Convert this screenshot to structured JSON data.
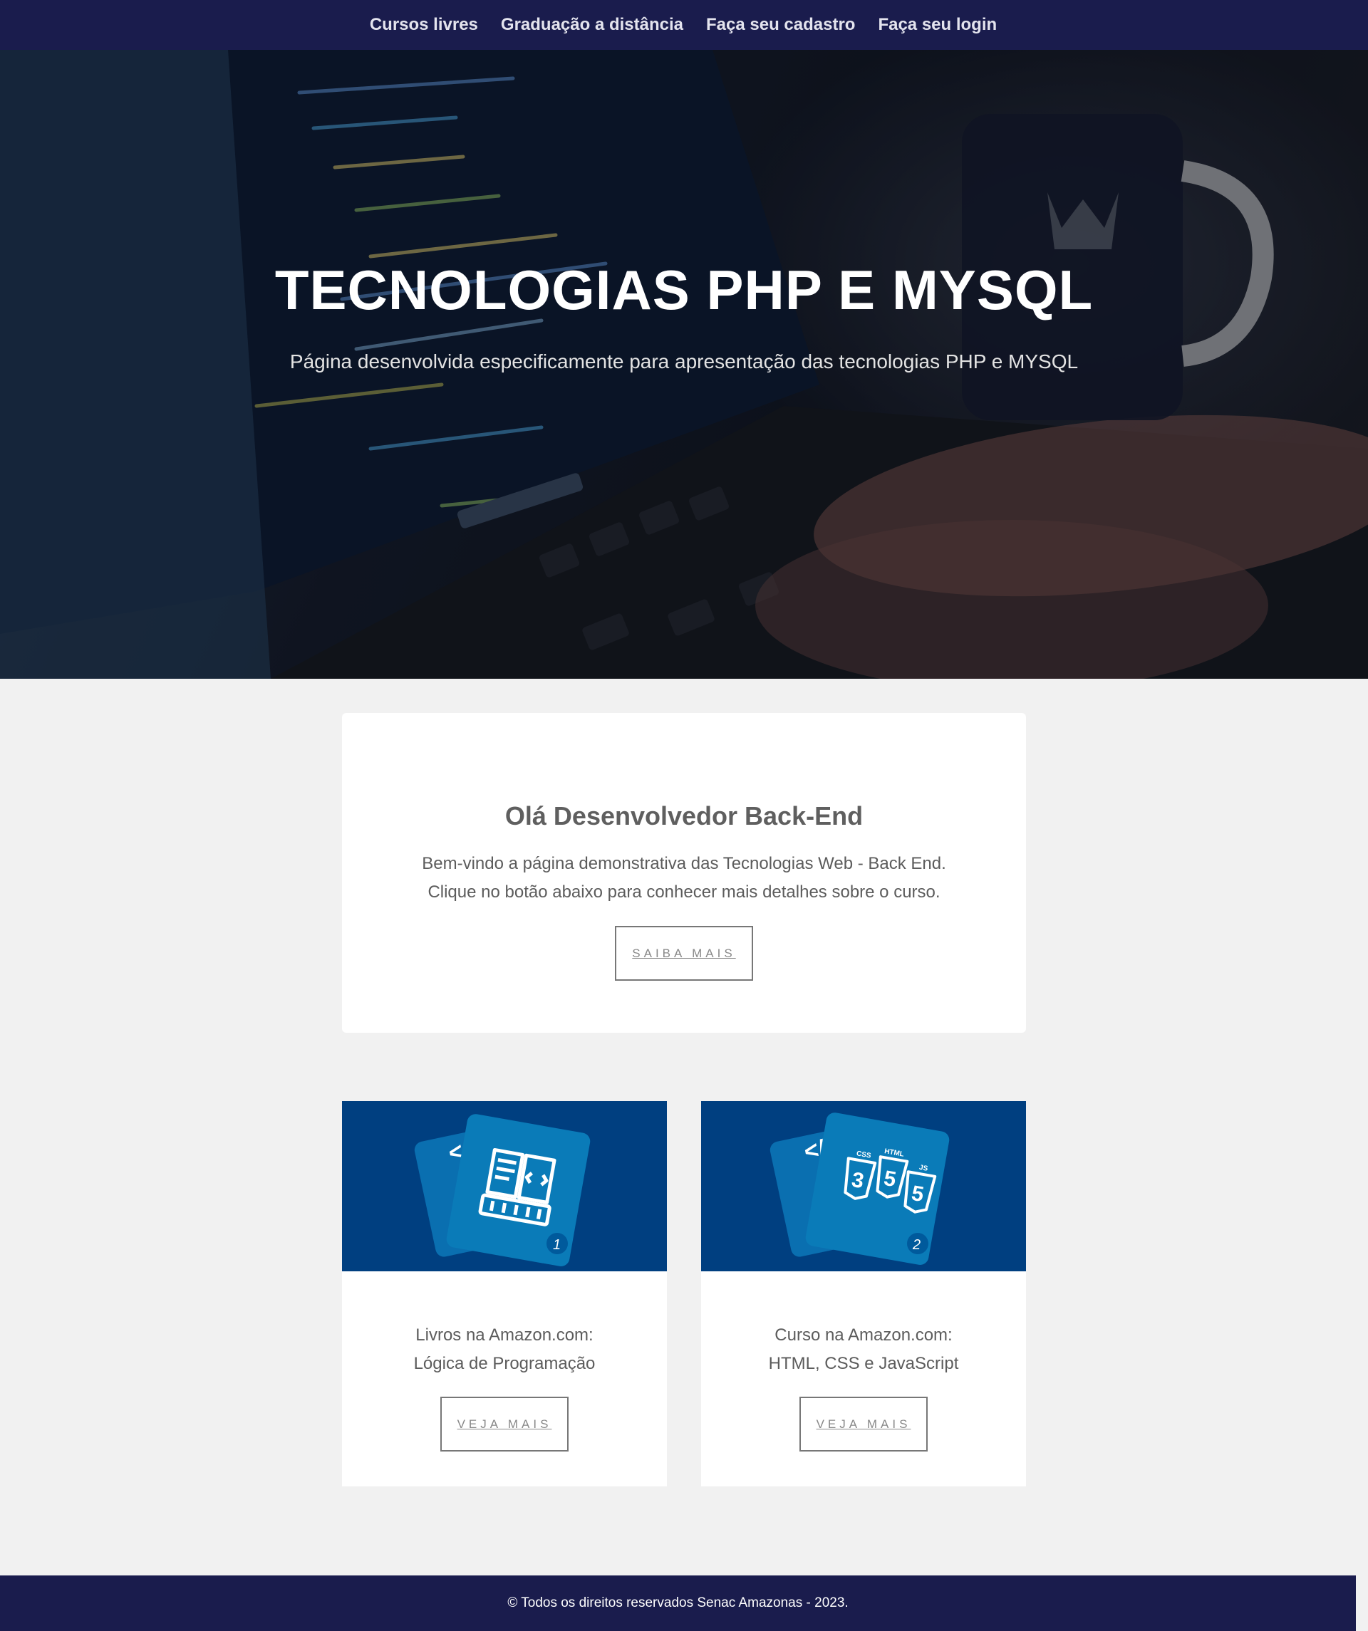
{
  "nav": {
    "items": [
      "Cursos livres",
      "Graduação a distância",
      "Faça seu cadastro",
      "Faça seu login"
    ]
  },
  "hero": {
    "title": "TECNOLOGIAS PHP E MYSQL",
    "subtitle": "Página desenvolvida especificamente para apresentação das tecnologias PHP e MYSQL"
  },
  "welcome": {
    "heading": "Olá Desenvolvedor Back-End",
    "line1": "Bem-vindo a página demonstrativa das Tecnologias Web - Back End.",
    "line2": "Clique no botão abaixo para conhecer mais detalhes sobre o curso.",
    "button": "SAIBA MAIS"
  },
  "cards": [
    {
      "line1": "Livros na Amazon.com:",
      "line2": "Lógica de Programação",
      "button": "VEJA MAIS",
      "badge": "1",
      "icon": "book-code-keyboard-icon"
    },
    {
      "line1": "Curso na Amazon.com:",
      "line2": "HTML, CSS e JavaScript",
      "button": "VEJA MAIS",
      "badge": "2",
      "icon": "css-html-js-shields-icon"
    }
  ],
  "card_art": {
    "code_tag": "</>",
    "css": "CSS",
    "html": "HTML",
    "js": "JS"
  },
  "footer": {
    "text": "© Todos os direitos reservados Senac Amazonas - 2023."
  },
  "colors": {
    "nav": "#1a1c4d",
    "card_image": "#003f80",
    "tile": "#0a7bb8"
  }
}
